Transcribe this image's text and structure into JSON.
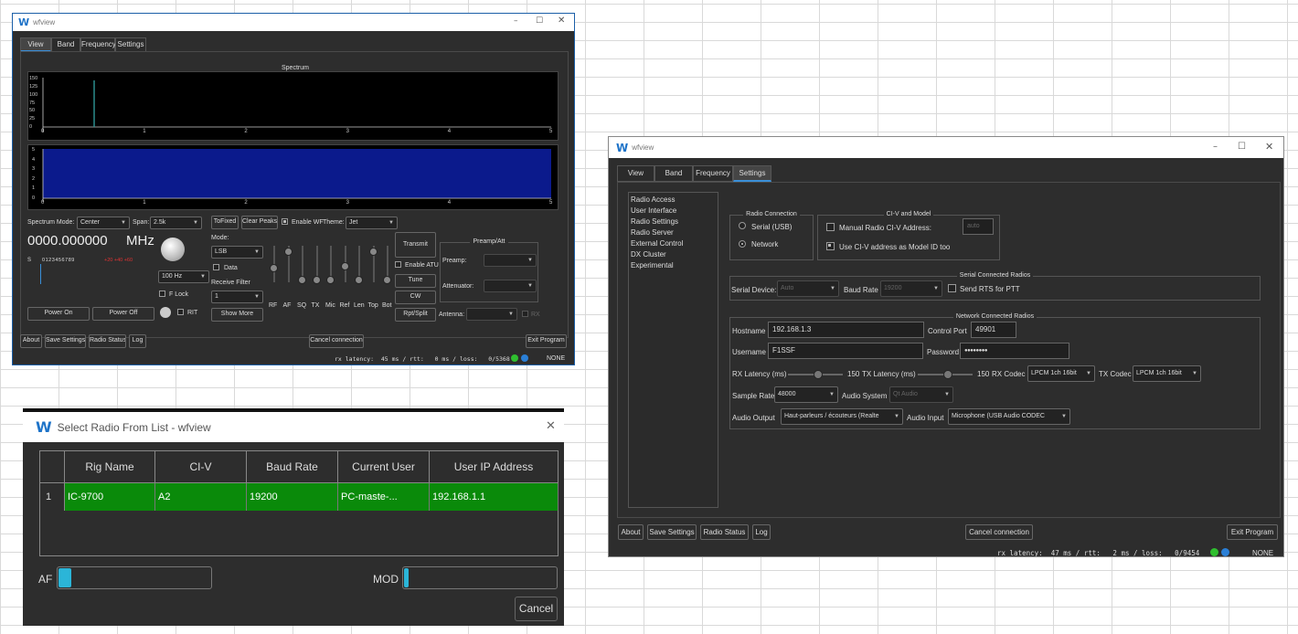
{
  "main_window": {
    "title": "wfview",
    "tabs": [
      "View",
      "Band",
      "Frequency",
      "Settings"
    ],
    "spectrum": {
      "title": "Spectrum",
      "y_ticks": [
        "150",
        "125",
        "100",
        "75",
        "50",
        "25",
        "0"
      ],
      "x_ticks": [
        "0",
        "1",
        "2",
        "3",
        "4",
        "5"
      ],
      "wf_y_ticks": [
        "5",
        "4",
        "3",
        "2",
        "1",
        "0"
      ],
      "peak_x": 0.5
    },
    "controls": {
      "spectrum_mode_label": "Spectrum Mode:",
      "spectrum_mode_value": "Center",
      "span_label": "Span:",
      "span_value": "2.5k",
      "to_fixed": "ToFixed",
      "clear_peaks": "Clear Peaks",
      "enable_wf": "Enable WF",
      "theme_label": "Theme:",
      "theme_value": "Jet",
      "frequency": "0000.000000",
      "mhz": "MHz",
      "s_meter_label": "S",
      "s_scale": "0 1 2 3 4 5 6 7 8 9",
      "s_scale_plus": "+20 +40 +60",
      "step_value": "100 Hz",
      "f_lock": "F Lock",
      "rit": "RIT",
      "mode_label": "Mode:",
      "mode_value": "LSB",
      "data_label": "Data",
      "receive_filter_label": "Receive Filter",
      "receive_filter_value": "1",
      "show_more": "Show More",
      "slider_labels": [
        "RF",
        "AF",
        "SQ",
        "TX",
        "Mic",
        "Ref",
        "Len",
        "Top",
        "Bot"
      ],
      "transmit": "Transmit",
      "enable_atu": "Enable ATU",
      "tune": "Tune",
      "cw": "CW",
      "rpt_split": "Rpt/Split",
      "preamp_att_title": "Preamp/Att",
      "preamp_label": "Preamp:",
      "attenuator_label": "Attenuator:",
      "antenna_label": "Antenna:",
      "rx_label": "RX",
      "power_on": "Power On",
      "power_off": "Power Off"
    },
    "bottom": {
      "about": "About",
      "save_settings": "Save Settings",
      "radio_status": "Radio Status",
      "log": "Log",
      "cancel_connection": "Cancel connection",
      "exit_program": "Exit Program"
    },
    "status": {
      "latency": "rx latency:  45 ms / rtt:   0 ms / loss:   0/5368",
      "none": "NONE"
    }
  },
  "settings_window": {
    "title": "wfview",
    "tabs": [
      "View",
      "Band",
      "Frequency",
      "Settings"
    ],
    "sidebar": [
      "Radio Access",
      "User Interface",
      "Radio Settings",
      "Radio Server",
      "External Control",
      "DX Cluster",
      "Experimental"
    ],
    "radio_connection": {
      "title": "Radio Connection",
      "serial": "Serial (USB)",
      "network": "Network"
    },
    "civ_model": {
      "title": "CI-V and Model",
      "manual_civ": "Manual Radio CI-V Address:",
      "civ_value": "auto",
      "use_civ_model": "Use CI-V address as Model ID too"
    },
    "serial_radios": {
      "title": "Serial Connected Radios",
      "serial_device_label": "Serial Device:",
      "serial_device_value": "Auto",
      "baud_label": "Baud Rate",
      "baud_value": "19200",
      "send_rts": "Send RTS for PTT"
    },
    "network_radios": {
      "title": "Network Connected Radios",
      "hostname_label": "Hostname",
      "hostname": "192.168.1.3",
      "control_port_label": "Control Port",
      "control_port": "49901",
      "username_label": "Username",
      "username": "F1SSF",
      "password_label": "Password",
      "password": "●●●●●●●●",
      "rx_latency_label": "RX Latency (ms)",
      "rx_latency": "150",
      "rx_latency_level": 0.55,
      "tx_latency_label": "TX Latency (ms)",
      "tx_latency": "150",
      "tx_latency_level": 0.55,
      "rx_codec_label": "RX Codec",
      "rx_codec": "LPCM 1ch 16bit",
      "tx_codec_label": "TX Codec",
      "tx_codec": "LPCM 1ch 16bit",
      "sample_rate_label": "Sample Rate",
      "sample_rate": "48000",
      "audio_system_label": "Audio System",
      "audio_system": "Qt Audio",
      "audio_output_label": "Audio Output",
      "audio_output": "Haut-parleurs / écouteurs (Realte",
      "audio_input_label": "Audio Input",
      "audio_input": "Microphone (USB Audio CODEC"
    },
    "bottom": {
      "about": "About",
      "save_settings": "Save Settings",
      "radio_status": "Radio Status",
      "log": "Log",
      "cancel_connection": "Cancel connection",
      "exit_program": "Exit Program"
    },
    "status": {
      "latency": "rx latency:  47 ms / rtt:   2 ms / loss:   0/9454",
      "none": "NONE"
    }
  },
  "select_dialog": {
    "title": "Select Radio From List - wfview",
    "columns": [
      "Rig Name",
      "CI-V",
      "Baud Rate",
      "Current User",
      "User IP Address"
    ],
    "row_number": "1",
    "row": [
      "IC-9700",
      "A2",
      "19200",
      "PC-maste-...",
      "192.168.1.1"
    ],
    "af_label": "AF",
    "mod_label": "MOD",
    "cancel": "Cancel"
  },
  "colors": {
    "accent": "#3a8fd8",
    "selected_row": "#0a8a0a",
    "waterfall": "#0b1a8c",
    "meter": "#2bb5d8"
  }
}
